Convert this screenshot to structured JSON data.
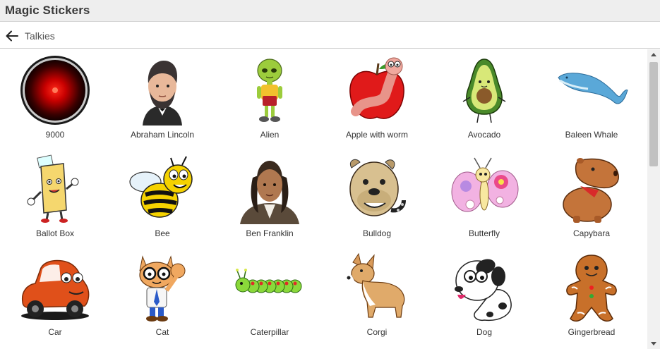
{
  "app": {
    "title": "Magic Stickers"
  },
  "nav": {
    "crumb": "Talkies"
  },
  "stickers": [
    {
      "label": "9000",
      "icon": "red-eye-lens-icon"
    },
    {
      "label": "Abraham Lincoln",
      "icon": "abraham-lincoln-icon"
    },
    {
      "label": "Alien",
      "icon": "alien-icon"
    },
    {
      "label": "Apple with worm",
      "icon": "apple-worm-icon"
    },
    {
      "label": "Avocado",
      "icon": "avocado-icon"
    },
    {
      "label": "Baleen Whale",
      "icon": "whale-icon"
    },
    {
      "label": "Ballot Box",
      "icon": "ballot-box-icon"
    },
    {
      "label": "Bee",
      "icon": "bee-icon"
    },
    {
      "label": "Ben Franklin",
      "icon": "ben-franklin-icon"
    },
    {
      "label": "Bulldog",
      "icon": "bulldog-icon"
    },
    {
      "label": "Butterfly",
      "icon": "butterfly-icon"
    },
    {
      "label": "Capybara",
      "icon": "capybara-icon"
    },
    {
      "label": "Car",
      "icon": "car-icon"
    },
    {
      "label": "Cat",
      "icon": "cat-icon"
    },
    {
      "label": "Caterpillar",
      "icon": "caterpillar-icon"
    },
    {
      "label": "Corgi",
      "icon": "corgi-icon"
    },
    {
      "label": "Dog",
      "icon": "dog-icon"
    },
    {
      "label": "Gingerbread",
      "icon": "gingerbread-icon"
    }
  ]
}
